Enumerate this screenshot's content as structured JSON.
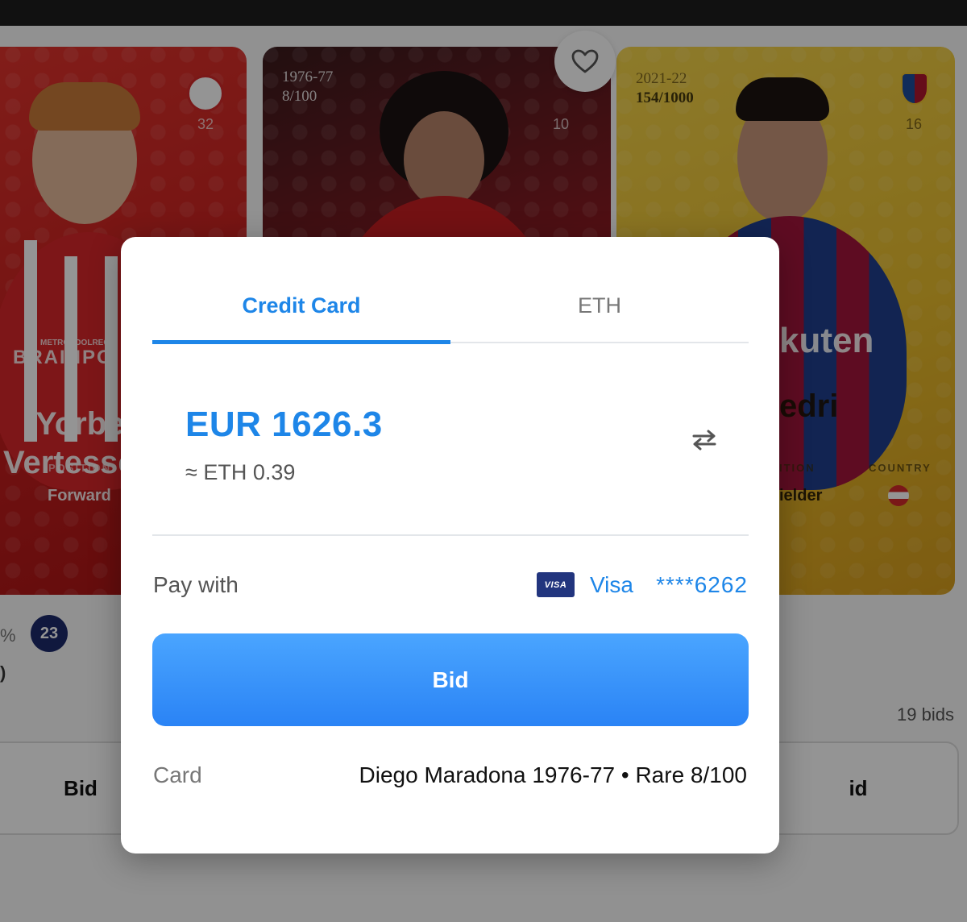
{
  "background": {
    "cards": [
      {
        "season": "",
        "serial": "",
        "number": "32",
        "name_line1": "Yorbe",
        "name_line2": "Vertesse",
        "sponsor": "BRAINPO",
        "sponsor_sub": "METROPOOLREGI",
        "position_label": "POSITION",
        "position_value": "Forward"
      },
      {
        "season": "1976-77",
        "serial": "8/100",
        "number": "10"
      },
      {
        "season": "2021-22",
        "serial": "154/1000",
        "number": "16",
        "name": "edri",
        "sponsor": "kuten",
        "position_label": "ITION",
        "position_value": "ielder",
        "country_label": "COUNTRY"
      }
    ],
    "left_info": {
      "percent_fragment": "%",
      "badge": "23",
      "fragment": ")"
    },
    "right_info": {
      "bids": "19 bids"
    },
    "ghost_buttons": [
      "Bid",
      "id"
    ]
  },
  "modal": {
    "tabs": [
      {
        "label": "Credit Card",
        "active": true
      },
      {
        "label": "ETH",
        "active": false
      }
    ],
    "amount": "EUR 1626.3",
    "approx": "≈ ETH 0.39",
    "swap_icon": "swap-arrows-icon",
    "pay_with_label": "Pay with",
    "payment": {
      "icon_text": "VISA",
      "brand": "Visa",
      "digits": "****6262"
    },
    "bid_label": "Bid",
    "card_label": "Card",
    "card_value": "Diego Maradona 1976-77 • Rare 8/100"
  },
  "colors": {
    "accent": "#1e86e8",
    "bid_button_top": "#4aa5ff",
    "bid_button_bottom": "#2a83f5",
    "visa_blue": "#22357e"
  }
}
